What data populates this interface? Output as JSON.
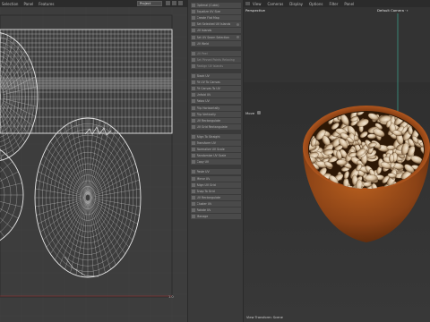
{
  "uv_editor": {
    "menu": [
      "Selection",
      "Panel",
      "Features"
    ],
    "projection_select": "Project",
    "scale_readout": "1.0"
  },
  "commands": [
    {
      "label": "Optimal (Cubic)",
      "enabled": true
    },
    {
      "label": "Equalize UV Size",
      "enabled": true
    },
    {
      "label": "Create Flat Map",
      "enabled": true
    },
    {
      "label": "Set Selected UV Islands",
      "enabled": true
    },
    {
      "label": "UV Islands",
      "enabled": true
    },
    {
      "label": "Set UV Seam Selection",
      "enabled": true
    },
    {
      "label": "UV Weld",
      "enabled": true
    },
    {
      "label": "UV Peel",
      "enabled": false
    },
    {
      "label": "Set Pinned Points Relaxing",
      "enabled": false
    },
    {
      "label": "Realign UV Islands",
      "enabled": false
    },
    {
      "label": "Stack UV",
      "enabled": true
    },
    {
      "label": "Fit UV To Canvas",
      "enabled": true
    },
    {
      "label": "Fit Canvas To UV",
      "enabled": true
    },
    {
      "label": "Unfold UV",
      "enabled": true
    },
    {
      "label": "Relax UV",
      "enabled": true
    },
    {
      "label": "Flip Horizontally",
      "enabled": true
    },
    {
      "label": "Flip Vertically",
      "enabled": true
    },
    {
      "label": "UV Rectangulate",
      "enabled": true
    },
    {
      "label": "UV Grid Rectangulate",
      "enabled": true
    },
    {
      "label": "Align To Straight",
      "enabled": true
    },
    {
      "label": "Transform UV",
      "enabled": true
    },
    {
      "label": "Normalize UV Scale",
      "enabled": true
    },
    {
      "label": "Randomize UV Scale",
      "enabled": true
    },
    {
      "label": "Copy UV",
      "enabled": true
    },
    {
      "label": "Paste UV",
      "enabled": true
    },
    {
      "label": "Mirror UV",
      "enabled": true
    },
    {
      "label": "Align UV Grid",
      "enabled": true
    },
    {
      "label": "Snap To Grid",
      "enabled": true
    },
    {
      "label": "UV Rectangulate",
      "enabled": true
    },
    {
      "label": "Cluster UV",
      "enabled": true
    },
    {
      "label": "Rotate UV",
      "enabled": true
    },
    {
      "label": "Manage",
      "enabled": true
    }
  ],
  "viewport": {
    "menu": [
      "View",
      "Cameras",
      "Display",
      "Options",
      "Filter",
      "Panel"
    ],
    "view_name": "Perspective",
    "camera": "Default Camera ·∘",
    "tool_button": "Move",
    "footer": "View Transform: Scene"
  },
  "colors": {
    "wireframe": "#e8e8e8",
    "bowl_outer": "#8a4216",
    "bowl_rim": "#b0561e",
    "seed_light": "#e2d2bc",
    "seed_dark": "#6b4c2e",
    "axis_line": "#3fbfa4"
  }
}
